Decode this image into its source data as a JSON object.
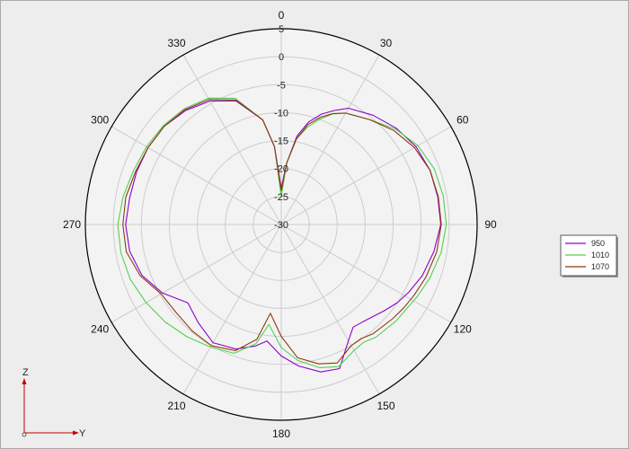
{
  "chart_data": {
    "type": "polar",
    "title": "",
    "angle_labels": [
      "0",
      "30",
      "60",
      "90",
      "120",
      "150",
      "180",
      "210",
      "240",
      "270",
      "300",
      "330"
    ],
    "angle_values": [
      0,
      30,
      60,
      90,
      120,
      150,
      180,
      210,
      240,
      270,
      300,
      330
    ],
    "radial_labels": [
      "5",
      "0",
      "-5",
      "-10",
      "-15",
      "-20",
      "-25",
      "-30"
    ],
    "rlim": [
      -30,
      5
    ],
    "grid": true,
    "legend_position": "right",
    "series": [
      {
        "name": "950",
        "color": "#8b00c9",
        "points": [
          [
            0,
            -23.5
          ],
          [
            5,
            -19
          ],
          [
            10,
            -14
          ],
          [
            15,
            -11
          ],
          [
            20,
            -9
          ],
          [
            25,
            -7.5
          ],
          [
            30,
            -6
          ],
          [
            40,
            -4.5
          ],
          [
            50,
            -3.2
          ],
          [
            60,
            -2.2
          ],
          [
            70,
            -1.7
          ],
          [
            80,
            -1.6
          ],
          [
            90,
            -1.5
          ],
          [
            100,
            -2.3
          ],
          [
            110,
            -3.2
          ],
          [
            118,
            -4.2
          ],
          [
            124,
            -5
          ],
          [
            130,
            -6
          ],
          [
            140,
            -7.3
          ],
          [
            145,
            -7.6
          ],
          [
            150,
            -6
          ],
          [
            158,
            -2.2
          ],
          [
            165,
            -2.7
          ],
          [
            173,
            -4.5
          ],
          [
            180,
            -6.5
          ],
          [
            187,
            -9
          ],
          [
            192,
            -7.8
          ],
          [
            200,
            -6.3
          ],
          [
            210,
            -5.6
          ],
          [
            220,
            -7
          ],
          [
            230,
            -8.2
          ],
          [
            240,
            -5.5
          ],
          [
            250,
            -3.5
          ],
          [
            260,
            -2.5
          ],
          [
            270,
            -2.2
          ],
          [
            280,
            -2.5
          ],
          [
            290,
            -2.5
          ],
          [
            300,
            -2.5
          ],
          [
            310,
            -2.7
          ],
          [
            320,
            -3.4
          ],
          [
            330,
            -4.5
          ],
          [
            340,
            -6.5
          ],
          [
            350,
            -11
          ],
          [
            355,
            -16
          ],
          [
            360,
            -23.5
          ]
        ]
      },
      {
        "name": "1010",
        "color": "#52d052",
        "points": [
          [
            0,
            -25
          ],
          [
            5,
            -19
          ],
          [
            10,
            -14.5
          ],
          [
            15,
            -12
          ],
          [
            20,
            -10
          ],
          [
            25,
            -8.2
          ],
          [
            30,
            -7
          ],
          [
            40,
            -5.5
          ],
          [
            50,
            -3.4
          ],
          [
            60,
            -1.8
          ],
          [
            70,
            -0.9
          ],
          [
            80,
            -0.6
          ],
          [
            90,
            -0.5
          ],
          [
            100,
            -1
          ],
          [
            110,
            -1.8
          ],
          [
            118,
            -2.5
          ],
          [
            124,
            -3
          ],
          [
            130,
            -3.2
          ],
          [
            140,
            -3.7
          ],
          [
            145,
            -4.3
          ],
          [
            150,
            -4
          ],
          [
            158,
            -2.6
          ],
          [
            165,
            -3.5
          ],
          [
            173,
            -5.5
          ],
          [
            180,
            -8
          ],
          [
            187,
            -12
          ],
          [
            192,
            -8.2
          ],
          [
            200,
            -5.5
          ],
          [
            210,
            -4.7
          ],
          [
            220,
            -3.8
          ],
          [
            230,
            -2.9
          ],
          [
            240,
            -2.1
          ],
          [
            250,
            -1.3
          ],
          [
            260,
            -0.9
          ],
          [
            270,
            -0.8
          ],
          [
            280,
            -1.3
          ],
          [
            290,
            -1.9
          ],
          [
            300,
            -2.2
          ],
          [
            310,
            -2.5
          ],
          [
            320,
            -3
          ],
          [
            330,
            -3.9
          ],
          [
            340,
            -6
          ],
          [
            350,
            -11
          ],
          [
            355,
            -16
          ],
          [
            360,
            -25
          ]
        ]
      },
      {
        "name": "1070",
        "color": "#8b3a0d",
        "points": [
          [
            0,
            -24
          ],
          [
            5,
            -19
          ],
          [
            10,
            -14.5
          ],
          [
            15,
            -11.5
          ],
          [
            20,
            -9.6
          ],
          [
            25,
            -8.1
          ],
          [
            30,
            -7
          ],
          [
            40,
            -5.5
          ],
          [
            50,
            -3.8
          ],
          [
            60,
            -2.5
          ],
          [
            70,
            -1.7
          ],
          [
            80,
            -1.5
          ],
          [
            90,
            -1.4
          ],
          [
            100,
            -1.8
          ],
          [
            110,
            -2.5
          ],
          [
            118,
            -3.1
          ],
          [
            124,
            -3.5
          ],
          [
            130,
            -3.9
          ],
          [
            140,
            -4.5
          ],
          [
            145,
            -5.1
          ],
          [
            150,
            -5
          ],
          [
            158,
            -3.3
          ],
          [
            165,
            -4.2
          ],
          [
            173,
            -6
          ],
          [
            180,
            -10
          ],
          [
            187,
            -14
          ],
          [
            192,
            -9
          ],
          [
            200,
            -6
          ],
          [
            210,
            -5
          ],
          [
            220,
            -5.2
          ],
          [
            230,
            -5.5
          ],
          [
            240,
            -5.2
          ],
          [
            250,
            -3.2
          ],
          [
            260,
            -1.9
          ],
          [
            270,
            -1.7
          ],
          [
            280,
            -1.8
          ],
          [
            290,
            -2.3
          ],
          [
            300,
            -2.5
          ],
          [
            310,
            -2.7
          ],
          [
            320,
            -3.2
          ],
          [
            330,
            -4.2
          ],
          [
            340,
            -6.3
          ],
          [
            350,
            -11
          ],
          [
            355,
            -16
          ],
          [
            360,
            -24
          ]
        ]
      }
    ]
  },
  "triad": {
    "z_label": "Z",
    "y_label": "Y"
  },
  "colors": {
    "background": "#ececec",
    "grid": "#cccccc",
    "outer_ring": "#000000"
  }
}
